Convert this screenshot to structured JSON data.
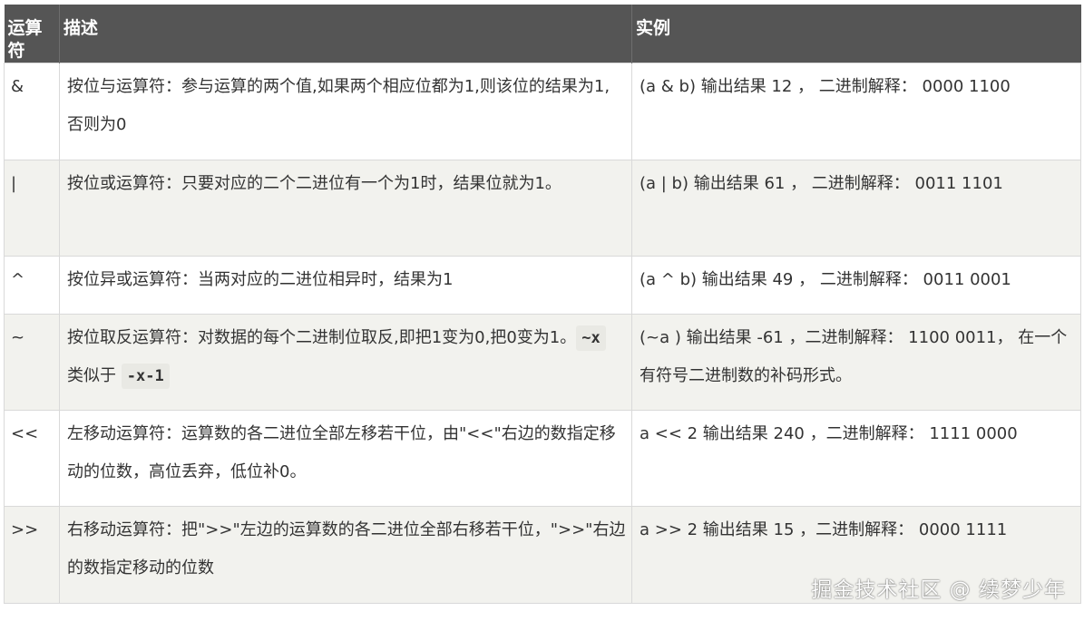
{
  "table": {
    "headers": [
      "运算符",
      "描述",
      "实例"
    ],
    "rows": [
      {
        "op": "&",
        "desc": "按位与运算符：参与运算的两个值,如果两个相应位都为1,则该位的结果为1,否则为0",
        "example": "(a & b) 输出结果 12 ， 二进制解释： 0000 1100"
      },
      {
        "op": "|",
        "desc": "按位或运算符：只要对应的二个二进位有一个为1时，结果位就为1。",
        "example": "(a | b) 输出结果 61 ， 二进制解释： 0011 1101"
      },
      {
        "op": "^",
        "desc": "按位异或运算符：当两对应的二进位相异时，结果为1",
        "example": "(a ^ b) 输出结果 49 ， 二进制解释： 0011 0001"
      },
      {
        "op": "~",
        "desc_before": "按位取反运算符：对数据的每个二进制位取反,即把1变为0,把0变为1。",
        "code1": "~x",
        "desc_mid": " 类似于 ",
        "code2": "-x-1",
        "example": "(~a ) 输出结果 -61 ，二进制解释： 1100 0011， 在一个有符号二进制数的补码形式。"
      },
      {
        "op": "<<",
        "desc": "左移动运算符：运算数的各二进位全部左移若干位，由\"<<\"右边的数指定移动的位数，高位丢弃，低位补0。",
        "example": "a << 2 输出结果 240 ，二进制解释： 1111 0000"
      },
      {
        "op": ">>",
        "desc": "右移动运算符：把\">>\"左边的运算数的各二进位全部右移若干位，\">>\"右边的数指定移动的位数",
        "example": "a >> 2 输出结果 15 ，二进制解释： 0000 1111"
      }
    ]
  },
  "watermark": "掘金技术社区 @ 续梦少年"
}
